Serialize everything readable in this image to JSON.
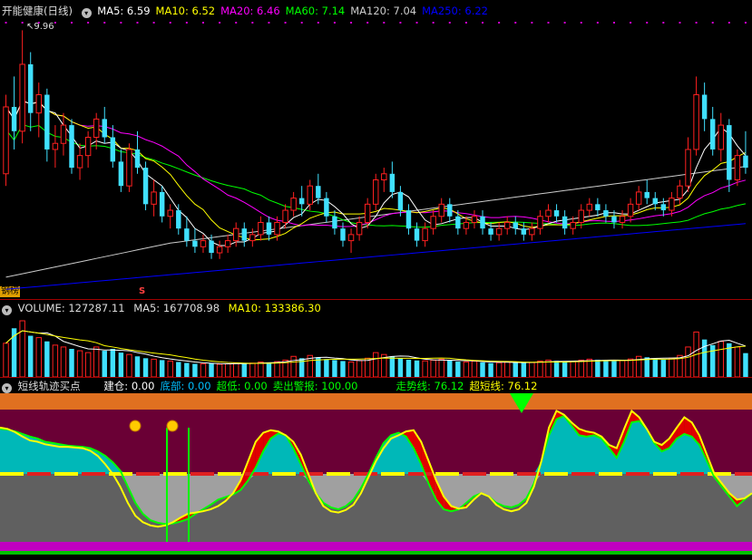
{
  "price_header": {
    "title": "开能健康(日线)",
    "ma": [
      {
        "label": "MA5: 6.59",
        "color": "#ffffff"
      },
      {
        "label": "MA10: 6.52",
        "color": "#ffff00"
      },
      {
        "label": "MA20: 6.46",
        "color": "#ff00ff"
      },
      {
        "label": "MA60: 7.14",
        "color": "#00ff00"
      },
      {
        "label": "MA120: 7.04",
        "color": "#cccccc"
      },
      {
        "label": "MA250: 6.22",
        "color": "#0000ff"
      }
    ],
    "high_marker": "9.96",
    "left_tag": "钢榜",
    "s_marker": "S"
  },
  "volume_header": {
    "label": "VOLUME: 127287.11",
    "ma5": "MA5: 167708.98",
    "ma10": "MA10: 133386.30"
  },
  "indicator_header": {
    "title": "短线轨迹买点",
    "items": [
      {
        "label": "建仓: 0.00",
        "color": "#ffffff"
      },
      {
        "label": "底部: 0.00",
        "color": "#00bfff"
      },
      {
        "label": "超低: 0.00",
        "color": "#00ff00"
      },
      {
        "label": "卖出警报: 100.00",
        "color": "#00ff00"
      },
      {
        "label": "走势线: 76.12",
        "color": "#00ff00"
      },
      {
        "label": "超短线: 76.12",
        "color": "#ffff00"
      }
    ]
  },
  "colors": {
    "up": "#ff2020",
    "down": "#40e0ff",
    "grid": "#a00000",
    "osc_top": "#6a0035",
    "osc_bottom": "#606060",
    "orange": "#e07020",
    "magenta": "#c000c0"
  },
  "candles": [
    [
      7.6,
      8.9,
      7.4,
      8.7
    ],
    [
      8.7,
      9.2,
      8.0,
      8.3
    ],
    [
      8.3,
      9.96,
      8.1,
      9.4
    ],
    [
      9.4,
      9.6,
      8.3,
      8.6
    ],
    [
      8.6,
      9.1,
      8.2,
      8.9
    ],
    [
      8.9,
      9.0,
      7.8,
      8.0
    ],
    [
      8.0,
      8.4,
      7.7,
      8.1
    ],
    [
      8.1,
      8.6,
      7.9,
      8.4
    ],
    [
      8.4,
      8.5,
      7.6,
      7.7
    ],
    [
      7.7,
      8.1,
      7.5,
      7.9
    ],
    [
      7.9,
      8.3,
      7.7,
      8.2
    ],
    [
      8.2,
      8.6,
      8.0,
      8.5
    ],
    [
      8.5,
      8.7,
      8.1,
      8.2
    ],
    [
      8.2,
      8.4,
      7.7,
      7.8
    ],
    [
      7.8,
      8.0,
      7.3,
      7.4
    ],
    [
      7.4,
      8.1,
      7.3,
      8.0
    ],
    [
      8.0,
      8.3,
      7.6,
      7.7
    ],
    [
      7.7,
      7.8,
      7.0,
      7.1
    ],
    [
      7.1,
      7.5,
      6.9,
      7.3
    ],
    [
      7.3,
      7.4,
      6.8,
      6.9
    ],
    [
      6.9,
      7.1,
      6.7,
      7.0
    ],
    [
      7.0,
      7.1,
      6.6,
      6.7
    ],
    [
      6.7,
      6.9,
      6.4,
      6.5
    ],
    [
      6.5,
      6.7,
      6.3,
      6.4
    ],
    [
      6.4,
      6.6,
      6.3,
      6.5
    ],
    [
      6.5,
      6.6,
      6.2,
      6.3
    ],
    [
      6.3,
      6.5,
      6.2,
      6.4
    ],
    [
      6.4,
      6.6,
      6.3,
      6.5
    ],
    [
      6.5,
      6.8,
      6.4,
      6.7
    ],
    [
      6.7,
      6.8,
      6.4,
      6.5
    ],
    [
      6.5,
      6.7,
      6.4,
      6.6
    ],
    [
      6.6,
      6.9,
      6.5,
      6.8
    ],
    [
      6.8,
      6.9,
      6.5,
      6.6
    ],
    [
      6.6,
      6.9,
      6.5,
      6.8
    ],
    [
      6.8,
      7.1,
      6.7,
      7.0
    ],
    [
      7.0,
      7.3,
      6.9,
      7.2
    ],
    [
      7.2,
      7.4,
      6.9,
      7.1
    ],
    [
      7.1,
      7.5,
      7.0,
      7.4
    ],
    [
      7.4,
      7.6,
      7.1,
      7.2
    ],
    [
      7.2,
      7.3,
      6.8,
      6.9
    ],
    [
      6.9,
      7.0,
      6.6,
      6.7
    ],
    [
      6.7,
      6.8,
      6.4,
      6.5
    ],
    [
      6.5,
      6.7,
      6.3,
      6.6
    ],
    [
      6.6,
      6.9,
      6.5,
      6.8
    ],
    [
      6.8,
      7.2,
      6.7,
      7.1
    ],
    [
      7.1,
      7.6,
      7.0,
      7.5
    ],
    [
      7.5,
      7.7,
      7.3,
      7.6
    ],
    [
      7.6,
      7.8,
      7.2,
      7.3
    ],
    [
      7.3,
      7.4,
      6.9,
      7.0
    ],
    [
      7.0,
      7.1,
      6.6,
      6.7
    ],
    [
      6.7,
      6.8,
      6.4,
      6.5
    ],
    [
      6.5,
      6.8,
      6.4,
      6.7
    ],
    [
      6.7,
      7.0,
      6.6,
      6.9
    ],
    [
      6.9,
      7.2,
      6.8,
      7.1
    ],
    [
      7.1,
      7.2,
      6.8,
      6.9
    ],
    [
      6.9,
      7.0,
      6.6,
      6.7
    ],
    [
      6.7,
      6.9,
      6.6,
      6.8
    ],
    [
      6.8,
      7.0,
      6.7,
      6.9
    ],
    [
      6.9,
      7.0,
      6.6,
      6.7
    ],
    [
      6.7,
      6.8,
      6.5,
      6.6
    ],
    [
      6.6,
      6.8,
      6.5,
      6.7
    ],
    [
      6.7,
      6.9,
      6.6,
      6.8
    ],
    [
      6.8,
      6.9,
      6.6,
      6.7
    ],
    [
      6.7,
      6.8,
      6.5,
      6.6
    ],
    [
      6.6,
      6.8,
      6.5,
      6.7
    ],
    [
      6.7,
      7.0,
      6.6,
      6.9
    ],
    [
      6.9,
      7.1,
      6.8,
      7.0
    ],
    [
      7.0,
      7.1,
      6.8,
      6.9
    ],
    [
      6.9,
      7.0,
      6.6,
      6.7
    ],
    [
      6.7,
      6.9,
      6.6,
      6.8
    ],
    [
      6.8,
      7.1,
      6.7,
      7.0
    ],
    [
      7.0,
      7.2,
      6.9,
      7.1
    ],
    [
      7.1,
      7.2,
      6.9,
      7.0
    ],
    [
      7.0,
      7.1,
      6.8,
      6.9
    ],
    [
      6.9,
      7.0,
      6.7,
      6.8
    ],
    [
      6.8,
      7.0,
      6.7,
      6.9
    ],
    [
      6.9,
      7.2,
      6.8,
      7.1
    ],
    [
      7.1,
      7.4,
      7.0,
      7.3
    ],
    [
      7.3,
      7.5,
      7.1,
      7.2
    ],
    [
      7.2,
      7.3,
      7.0,
      7.1
    ],
    [
      7.1,
      7.2,
      6.9,
      7.0
    ],
    [
      7.0,
      7.3,
      6.9,
      7.2
    ],
    [
      7.2,
      7.5,
      7.1,
      7.4
    ],
    [
      7.4,
      8.2,
      7.3,
      8.0
    ],
    [
      8.0,
      9.2,
      7.9,
      8.9
    ],
    [
      8.9,
      9.1,
      8.3,
      8.5
    ],
    [
      8.5,
      8.7,
      7.9,
      8.0
    ],
    [
      8.0,
      8.6,
      7.8,
      8.4
    ],
    [
      8.4,
      8.5,
      7.3,
      7.5
    ],
    [
      7.5,
      8.0,
      7.4,
      7.9
    ],
    [
      7.9,
      8.3,
      7.6,
      7.7
    ]
  ],
  "volume": [
    180000,
    260000,
    300000,
    220000,
    210000,
    190000,
    170000,
    160000,
    150000,
    140000,
    130000,
    160000,
    140000,
    150000,
    130000,
    120000,
    110000,
    100000,
    95000,
    90000,
    85000,
    80000,
    75000,
    70000,
    70000,
    72000,
    68000,
    70000,
    75000,
    72000,
    74000,
    80000,
    78000,
    82000,
    90000,
    110000,
    100000,
    115000,
    105000,
    95000,
    90000,
    85000,
    80000,
    88000,
    100000,
    130000,
    120000,
    110000,
    100000,
    92000,
    88000,
    86000,
    90000,
    95000,
    88000,
    82000,
    80000,
    84000,
    78000,
    74000,
    76000,
    80000,
    78000,
    75000,
    77000,
    85000,
    90000,
    86000,
    80000,
    82000,
    90000,
    95000,
    92000,
    88000,
    85000,
    88000,
    96000,
    110000,
    105000,
    98000,
    92000,
    100000,
    115000,
    160000,
    240000,
    200000,
    170000,
    190000,
    180000,
    160000,
    127287
  ],
  "oscillator": {
    "track": [
      70,
      69,
      66,
      62,
      58,
      55,
      50,
      48,
      46,
      44,
      43,
      42,
      40,
      35,
      28,
      18,
      5,
      -20,
      -45,
      -62,
      -72,
      -76,
      -78,
      -77,
      -74,
      -70,
      -62,
      -55,
      -48,
      -40,
      -36,
      -32,
      -25,
      -10,
      10,
      35,
      55,
      63,
      60,
      40,
      15,
      -10,
      -30,
      -45,
      -52,
      -55,
      -50,
      -40,
      -22,
      0,
      25,
      48,
      60,
      64,
      58,
      40,
      15,
      -15,
      -40,
      -55,
      -58,
      -55,
      -45,
      -35,
      -30,
      -35,
      -45,
      -50,
      -52,
      -48,
      -38,
      -15,
      20,
      60,
      85,
      90,
      75,
      60,
      58,
      60,
      55,
      40,
      25,
      50,
      80,
      82,
      70,
      48,
      35,
      40,
      55,
      62,
      58,
      45,
      20,
      -5,
      -20,
      -35,
      -50,
      -40,
      -30
    ],
    "fast": [
      72,
      70,
      65,
      58,
      52,
      50,
      46,
      44,
      42,
      42,
      41,
      40,
      36,
      28,
      15,
      0,
      -20,
      -45,
      -65,
      -75,
      -80,
      -82,
      -80,
      -75,
      -68,
      -62,
      -60,
      -58,
      -55,
      -50,
      -42,
      -30,
      -10,
      20,
      50,
      64,
      68,
      66,
      60,
      50,
      30,
      0,
      -30,
      -50,
      -58,
      -60,
      -56,
      -48,
      -30,
      -5,
      20,
      40,
      55,
      60,
      66,
      68,
      50,
      20,
      -10,
      -35,
      -50,
      -54,
      -52,
      -40,
      -30,
      -35,
      -48,
      -55,
      -58,
      -55,
      -45,
      -20,
      20,
      72,
      98,
      92,
      80,
      70,
      66,
      64,
      58,
      45,
      40,
      70,
      98,
      88,
      70,
      50,
      45,
      55,
      72,
      88,
      80,
      60,
      30,
      0,
      -15,
      -30,
      -40,
      -38,
      -30
    ]
  },
  "signals": [
    {
      "index": 17,
      "label": "buy-1"
    },
    {
      "index": 21,
      "label": "buy-2"
    }
  ]
}
